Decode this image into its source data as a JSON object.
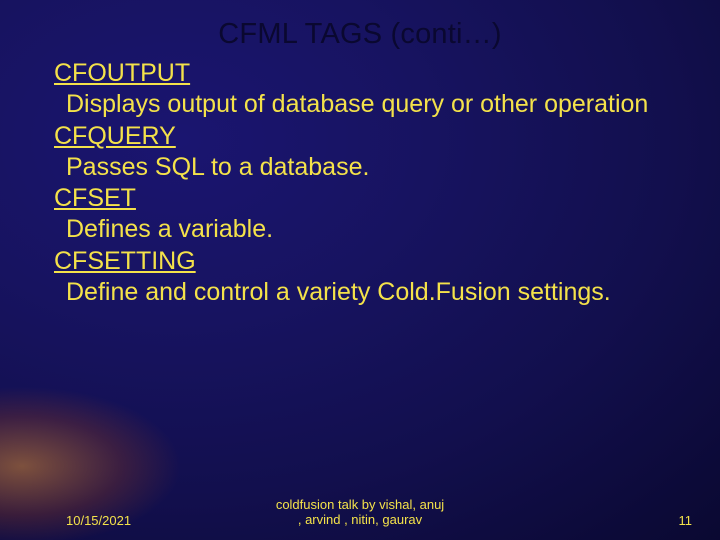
{
  "title": "CFML TAGS (conti…)",
  "items": [
    {
      "tag": "CFOUTPUT",
      "desc": "Displays output of database query or other operation"
    },
    {
      "tag": "CFQUERY",
      "desc": "Passes SQL to a database."
    },
    {
      "tag": "CFSET",
      "desc": "Defines a variable."
    },
    {
      "tag": "CFSETTING",
      "desc": "Define and control a variety Cold.Fusion settings."
    }
  ],
  "footer": {
    "date": "10/15/2021",
    "center_line1": "coldfusion talk by vishal, anuj",
    "center_line2": ", arvind , nitin, gaurav",
    "page": "11"
  }
}
